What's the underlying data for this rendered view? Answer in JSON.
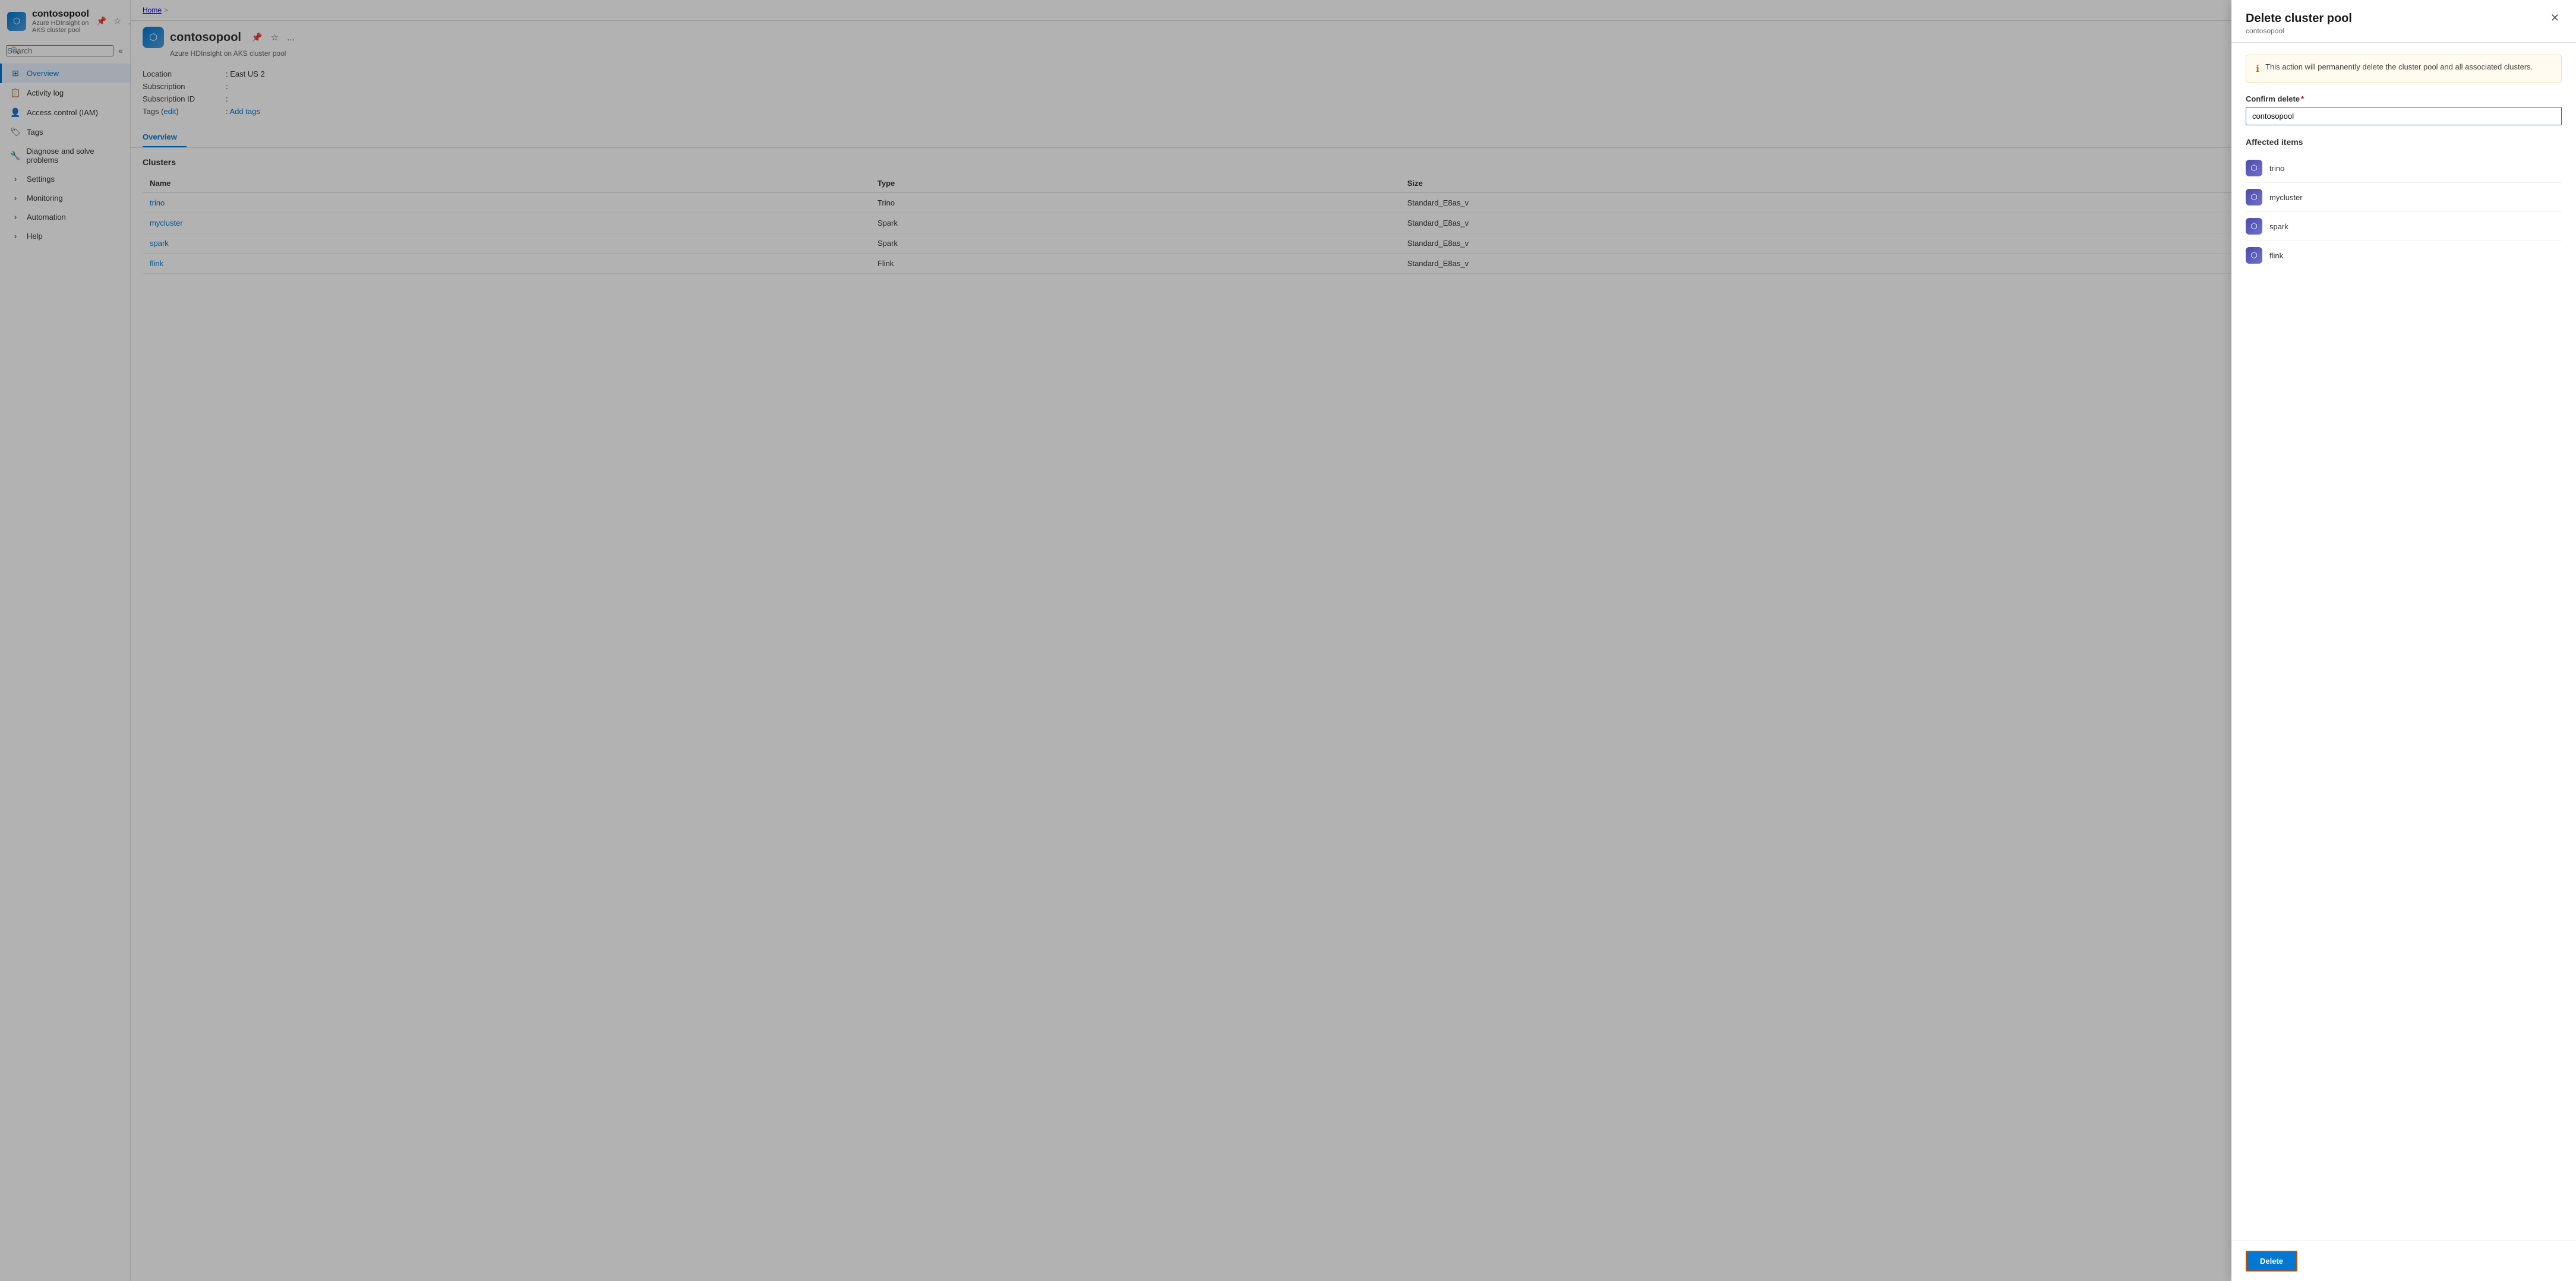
{
  "breadcrumb": {
    "home": "Home",
    "sep": ">"
  },
  "sidebar": {
    "logo_icon": "⬡",
    "title": "contosopool",
    "subtitle": "Azure HDInsight on AKS cluster pool",
    "search_placeholder": "Search",
    "collapse_icon": "«",
    "pin_icon": "📌",
    "star_icon": "☆",
    "more_icon": "...",
    "nav_items": [
      {
        "id": "overview",
        "label": "Overview",
        "icon": "⊞",
        "active": true
      },
      {
        "id": "activity-log",
        "label": "Activity log",
        "icon": "📋",
        "active": false
      },
      {
        "id": "access-control",
        "label": "Access control (IAM)",
        "icon": "👤",
        "active": false
      },
      {
        "id": "tags",
        "label": "Tags",
        "icon": "🏷",
        "active": false
      },
      {
        "id": "diagnose",
        "label": "Diagnose and solve problems",
        "icon": "🔧",
        "active": false
      },
      {
        "id": "settings",
        "label": "Settings",
        "icon": "›",
        "active": false,
        "expandable": true
      },
      {
        "id": "monitoring",
        "label": "Monitoring",
        "icon": "›",
        "active": false,
        "expandable": true
      },
      {
        "id": "automation",
        "label": "Automation",
        "icon": "›",
        "active": false,
        "expandable": true
      },
      {
        "id": "help",
        "label": "Help",
        "icon": "›",
        "active": false,
        "expandable": true
      }
    ]
  },
  "main": {
    "page_title": "contosopool",
    "page_subtitle": "Azure HDInsight on AKS cluster pool",
    "metadata": [
      {
        "label": "Location",
        "value": "East US 2",
        "is_link": false
      },
      {
        "label": "Subscription",
        "value": "",
        "is_link": false
      },
      {
        "label": "Subscription ID",
        "value": "",
        "is_link": false
      },
      {
        "label": "Tags (edit)",
        "edit_label": "edit",
        "value": "Add tags",
        "is_link": true
      }
    ],
    "tab_active": "Overview",
    "tabs": [
      "Overview"
    ],
    "clusters_section_label": "Clusters",
    "table_columns": [
      "Name",
      "Type",
      "Size"
    ],
    "table_rows": [
      {
        "name": "trino",
        "type": "Trino",
        "size": "Standard_E8as_v"
      },
      {
        "name": "mycluster",
        "type": "Spark",
        "size": "Standard_E8as_v"
      },
      {
        "name": "spark",
        "type": "Spark",
        "size": "Standard_E8as_v"
      },
      {
        "name": "flink",
        "type": "Flink",
        "size": "Standard_E8as_v"
      }
    ]
  },
  "delete_panel": {
    "title": "Delete cluster pool",
    "subtitle": "contosopool",
    "close_icon": "✕",
    "warning_text": "This action will permanently delete the cluster pool and all associated clusters.",
    "confirm_label": "Confirm delete",
    "required_marker": "*",
    "confirm_value": "contosopool",
    "confirm_placeholder": "contosopool",
    "affected_items_title": "Affected items",
    "affected_items": [
      {
        "name": "trino",
        "icon": "⬡"
      },
      {
        "name": "mycluster",
        "icon": "⬡"
      },
      {
        "name": "spark",
        "icon": "⬡"
      },
      {
        "name": "flink",
        "icon": "⬡"
      }
    ],
    "delete_button_label": "Delete"
  }
}
